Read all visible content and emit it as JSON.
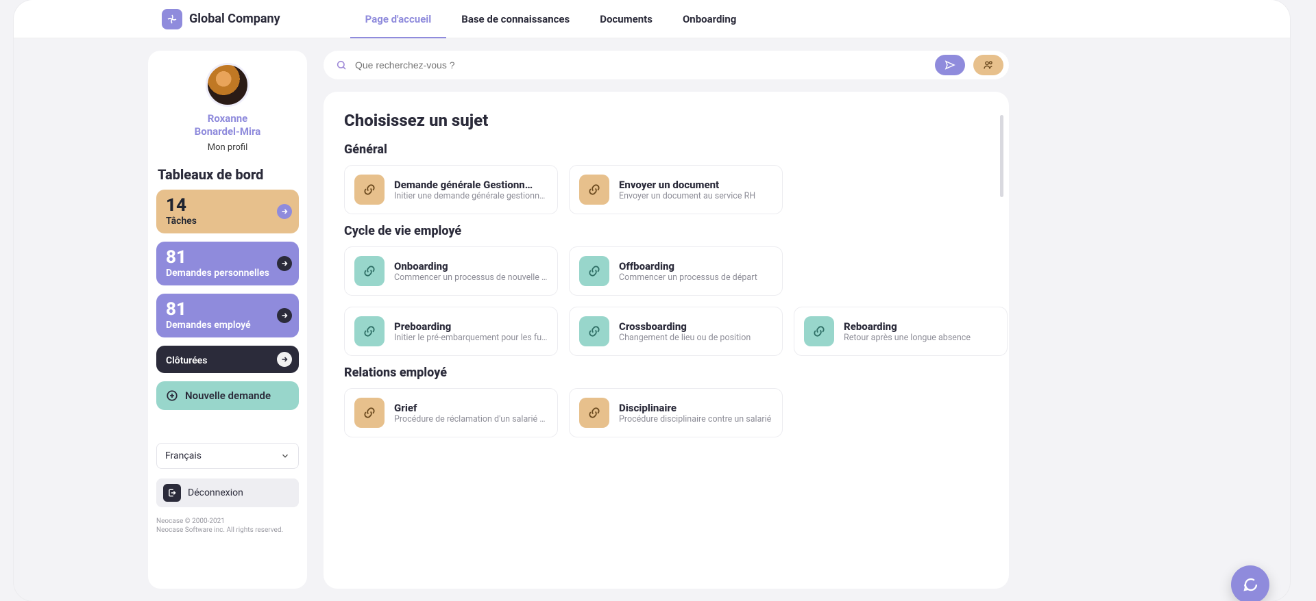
{
  "brand": "Global Company",
  "nav": {
    "home": "Page d'accueil",
    "kb": "Base de connaissances",
    "docs": "Documents",
    "onb": "Onboarding"
  },
  "search": {
    "placeholder": "Que recherchez-vous ?"
  },
  "user": {
    "first": "Roxanne",
    "last": "Bonardel-Mira",
    "profile_link": "Mon profil"
  },
  "sidebar": {
    "title": "Tableaux de bord",
    "cards": [
      {
        "num": "14",
        "label": "Tâches"
      },
      {
        "num": "81",
        "label": "Demandes personnelles"
      },
      {
        "num": "81",
        "label": "Demandes employé"
      },
      {
        "num": "",
        "label": "Clôturées"
      }
    ],
    "new_request": "Nouvelle demande",
    "language": "Français",
    "logout": "Déconnexion",
    "legal1": "Neocase © 2000-2021",
    "legal2": "Neocase Software inc. All rights reserved."
  },
  "panel": {
    "title": "Choisissez un sujet",
    "sections": {
      "general": {
        "heading": "Général",
        "items": [
          {
            "title": "Demande générale Gestionn…",
            "desc": "Initier une demande générale gestionnaire",
            "color": "sand"
          },
          {
            "title": "Envoyer un document",
            "desc": "Envoyer un document au service RH",
            "color": "sand"
          }
        ]
      },
      "cycle": {
        "heading": "Cycle de vie employé",
        "items": [
          {
            "title": "Onboarding",
            "desc": "Commencer un processus de nouvelle e…",
            "color": "mint"
          },
          {
            "title": "Offboarding",
            "desc": "Commencer un processus de départ",
            "color": "mint"
          },
          {
            "title": "Preboarding",
            "desc": "Initier le pré-embarquement pour les fut…",
            "color": "mint"
          },
          {
            "title": "Crossboarding",
            "desc": "Changement de lieu ou de position",
            "color": "mint"
          },
          {
            "title": "Reboarding",
            "desc": "Retour après une longue absence",
            "color": "mint"
          }
        ]
      },
      "relations": {
        "heading": "Relations employé",
        "items": [
          {
            "title": "Grief",
            "desc": "Procédure de réclamation d'un salarié c…",
            "color": "sand"
          },
          {
            "title": "Disciplinaire",
            "desc": "Procédure disciplinaire contre un salarié",
            "color": "sand"
          }
        ]
      }
    }
  }
}
